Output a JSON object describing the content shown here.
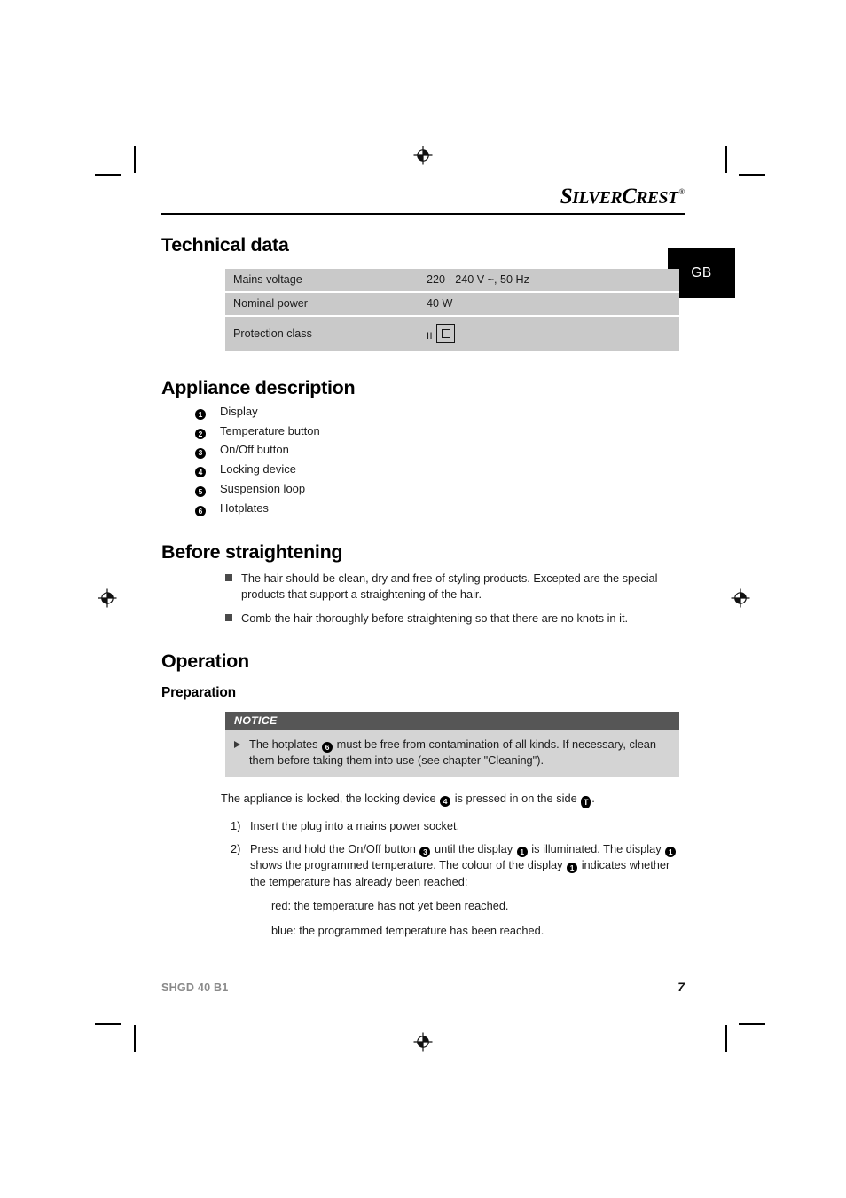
{
  "brand": {
    "name_first": "S",
    "name_first_rest": "ILVER",
    "name_second": "C",
    "name_second_rest": "REST",
    "registered_mark": "®"
  },
  "language_tab": {
    "label": "GB"
  },
  "sections": {
    "technical_data": {
      "heading": "Technical data",
      "table": {
        "rows": [
          {
            "key": "Mains voltage",
            "value": "220 - 240 V ~, 50 Hz"
          },
          {
            "key": "Nominal power",
            "value": "40 W"
          },
          {
            "key": "Protection class",
            "value": "II",
            "symbol": "class-2-double-insulation"
          }
        ]
      }
    },
    "appliance_description": {
      "heading": "Appliance description",
      "parts": [
        {
          "num": "1",
          "label": "Display"
        },
        {
          "num": "2",
          "label": "Temperature button"
        },
        {
          "num": "3",
          "label": "On/Off button"
        },
        {
          "num": "4",
          "label": "Locking device"
        },
        {
          "num": "5",
          "label": "Suspension loop"
        },
        {
          "num": "6",
          "label": "Hotplates"
        }
      ]
    },
    "before_straightening": {
      "heading": "Before straightening",
      "bullets": [
        "The hair should be clean, dry and free of styling products. Excepted are the special products that support a straightening of the hair.",
        "Comb the hair thoroughly before straightening so that there are no knots in it."
      ]
    },
    "operation": {
      "heading": "Operation",
      "subheading": "Preparation",
      "notice": {
        "title": "NOTICE",
        "text_part1": "The hotplates ",
        "ref1": "6",
        "text_part2": " must be free from contamination of all kinds. If necessary, clean them before taking them into use (see chapter \"Cleaning\")."
      },
      "locked_paragraph": {
        "part1": "The appliance is locked, the locking device ",
        "ref1": "4",
        "part2": " is pressed in on the side ",
        "ref2": "T",
        "part3": "."
      },
      "steps": [
        {
          "marker": "1)",
          "part1": "Insert the plug into a mains power socket."
        },
        {
          "marker": "2)",
          "part1": "Press and hold the On/Off button ",
          "ref1": "3",
          "part2": " until the display ",
          "ref2": "1",
          "part3": " is illuminated. The display ",
          "ref3": "1",
          "part4": " shows the programmed temperature. The colour of the display ",
          "ref4": "1",
          "part5": " indicates whether the temperature has already been reached:"
        }
      ],
      "sub_lines": [
        "red: the temperature has not yet been reached.",
        "blue: the programmed temperature has been reached."
      ]
    }
  },
  "footer": {
    "model": "SHGD 40 B1",
    "page_number": "7"
  },
  "colors": {
    "table_bg": "#c9c9c9",
    "notice_header_bg": "#565656",
    "notice_body_bg": "#d4d4d4",
    "tab_bg": "#000000",
    "footer_model": "#8a8a8a"
  }
}
